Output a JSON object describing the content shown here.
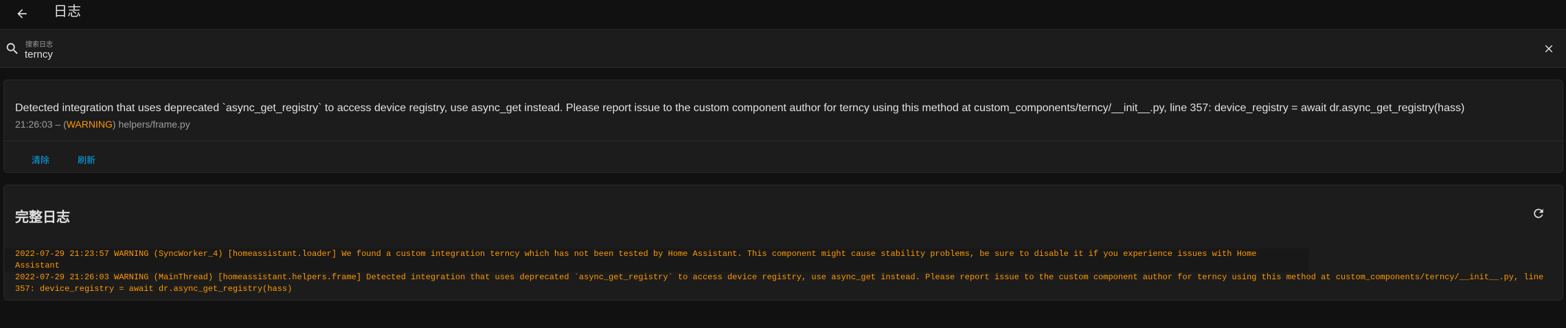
{
  "header": {
    "title": "日志"
  },
  "search": {
    "label": "搜索日志",
    "value": "terncy"
  },
  "entry": {
    "message": "Detected integration that uses deprecated `async_get_registry` to access device registry, use async_get instead. Please report issue to the custom component author for terncy using this method at custom_components/terncy/__init__.py, line 357: device_registry = await dr.async_get_registry(hass)",
    "time": "21:26:03",
    "meta_prefix": " – (",
    "level": "WARNING",
    "meta_suffix": ") helpers/frame.py",
    "actions": {
      "clear_label": "清除",
      "refresh_label": "刷新"
    }
  },
  "full_log": {
    "title": "完整日志",
    "lines": [
      "2022-07-29 21:23:57 WARNING (SyncWorker_4) [homeassistant.loader] We found a custom integration terncy which has not been tested by Home Assistant. This component might cause stability problems, be sure to disable it if you experience issues with Home Assistant",
      "2022-07-29 21:26:03 WARNING (MainThread) [homeassistant.helpers.frame] Detected integration that uses deprecated `async_get_registry` to access device registry, use async_get instead. Please report issue to the custom component author for terncy using this method at custom_components/terncy/__init__.py, line 357: device_registry = await dr.async_get_registry(hass)"
    ]
  },
  "icons": {
    "back": "arrow-left-icon",
    "search": "magnify-icon",
    "clear": "close-icon",
    "refresh": "refresh-icon"
  },
  "colors": {
    "background": "#111111",
    "card": "#1c1c1c",
    "accent": "#03a9f4",
    "warning": "#ff9800"
  }
}
